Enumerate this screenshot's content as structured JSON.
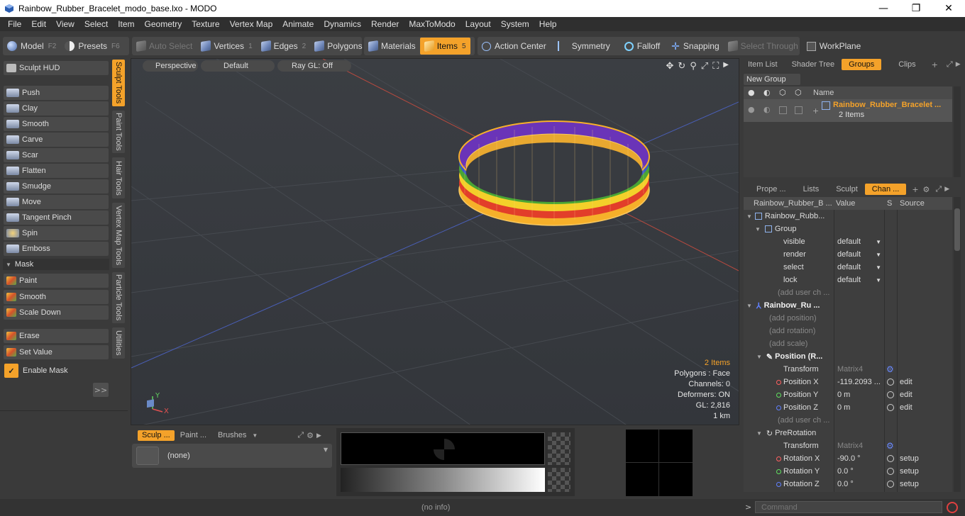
{
  "window": {
    "title": "Rainbow_Rubber_Bracelet_modo_base.lxo - MODO",
    "min": "—",
    "max": "❐",
    "close": "✕"
  },
  "menu": [
    "File",
    "Edit",
    "View",
    "Select",
    "Item",
    "Geometry",
    "Texture",
    "Vertex Map",
    "Animate",
    "Dynamics",
    "Render",
    "MaxToModo",
    "Layout",
    "System",
    "Help"
  ],
  "toolbar": {
    "model": "Model",
    "model_key": "F2",
    "presets": "Presets",
    "presets_key": "F6",
    "auto_select": "Auto Select",
    "vertices": "Vertices",
    "vertices_key": "1",
    "edges": "Edges",
    "edges_key": "2",
    "polygons": "Polygons",
    "materials": "Materials",
    "items": "Items",
    "items_key": "5",
    "action_center": "Action Center",
    "symmetry": "Symmetry",
    "falloff": "Falloff",
    "snapping": "Snapping",
    "select_through": "Select Through",
    "workplane": "WorkPlane"
  },
  "left": {
    "sculpt_hud": "Sculpt HUD",
    "tools": [
      "Push",
      "Clay",
      "Smooth",
      "Carve",
      "Scar",
      "Flatten",
      "Smudge",
      "Move",
      "Tangent Pinch",
      "Spin",
      "Emboss"
    ],
    "mask_header": "Mask",
    "mask_tools": [
      "Paint",
      "Smooth",
      "Scale Down"
    ],
    "other_tools": [
      "Erase",
      "Set Value"
    ],
    "enable_mask": "Enable Mask",
    "expand": ">>",
    "vtabs": [
      "Sculpt Tools",
      "Paint Tools",
      "Hair Tools",
      "Vertex Map Tools",
      "Particle Tools",
      "Utilities"
    ]
  },
  "viewport": {
    "view": "Perspective",
    "shading": "Default",
    "raygl": "Ray GL: Off",
    "stats": {
      "items": "2 Items",
      "polygons": "Polygons : Face",
      "channels": "Channels: 0",
      "deformers": "Deformers: ON",
      "gl": "GL: 2,816",
      "scale": "1 km"
    },
    "axis_y": "Y",
    "axis_x": "X"
  },
  "itemlist": {
    "tabs": [
      "Item List",
      "Shader Tree",
      "Groups",
      "Clips"
    ],
    "new_group": "New Group",
    "col_name": "Name",
    "group_name": "Rainbow_Rubber_Bracelet ...",
    "group_count": "2 Items"
  },
  "channels": {
    "tabs": [
      "Prope ...",
      "Lists",
      "Sculpt",
      "Chan ..."
    ],
    "headers": [
      "Rainbow_Rubber_B ...",
      "Value",
      "S",
      "Source"
    ],
    "root": "Rainbow_Rubb...",
    "group": "Group",
    "rows": [
      {
        "name": "visible",
        "value": "default"
      },
      {
        "name": "render",
        "value": "default"
      },
      {
        "name": "select",
        "value": "default"
      },
      {
        "name": "lock",
        "value": "default"
      }
    ],
    "add_user_ch": "(add user ch ...",
    "item": "Rainbow_Ru ...",
    "add_position": "(add position)",
    "add_rotation": "(add rotation)",
    "add_scale": "(add scale)",
    "position_header": "Position (R...",
    "transform": "Transform",
    "matrix4": "Matrix4",
    "position": [
      {
        "name": "Position X",
        "value": "-119.2093 ...",
        "source": "edit",
        "color": "#ff6060"
      },
      {
        "name": "Position Y",
        "value": "0 m",
        "source": "edit",
        "color": "#60e060"
      },
      {
        "name": "Position Z",
        "value": "0 m",
        "source": "edit",
        "color": "#6080ff"
      }
    ],
    "add_user_ch2": "(add user ch ...",
    "prerotation": "PreRotation",
    "transform2": "Transform",
    "matrix4_2": "Matrix4",
    "rotation": [
      {
        "name": "Rotation X",
        "value": "-90.0 °",
        "source": "setup",
        "color": "#ff6060"
      },
      {
        "name": "Rotation Y",
        "value": "0.0 °",
        "source": "setup",
        "color": "#60e060"
      },
      {
        "name": "Rotation Z",
        "value": "0.0 °",
        "source": "setup",
        "color": "#6080ff"
      }
    ]
  },
  "bottom": {
    "tabs": [
      "Sculp ...",
      "Paint ...",
      "Brushes"
    ],
    "brush": "(none)"
  },
  "status": {
    "info": "(no info)",
    "command_placeholder": "Command",
    "prompt": ">"
  }
}
